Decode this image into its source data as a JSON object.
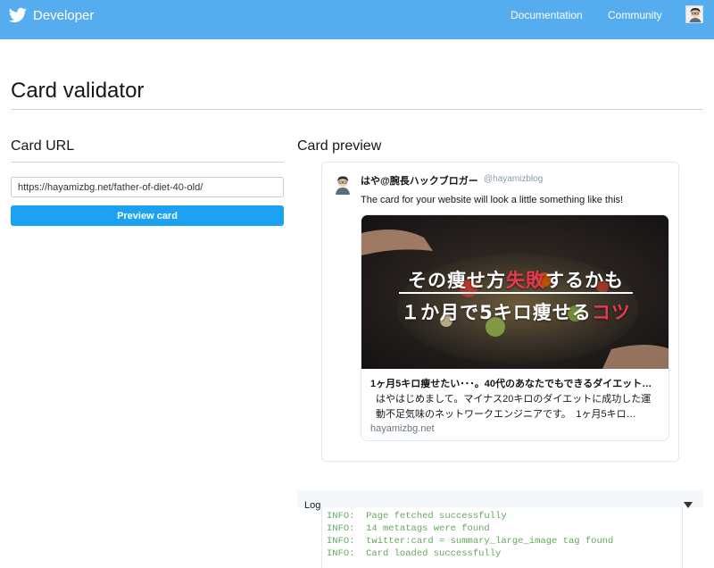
{
  "nav": {
    "brand": "Developer",
    "links": [
      "Documentation",
      "Community"
    ]
  },
  "page": {
    "title": "Card validator"
  },
  "card_url": {
    "heading": "Card URL",
    "input_value": "https://hayamizbg.net/father-of-diet-40-old/",
    "button_label": "Preview card"
  },
  "card_preview": {
    "heading": "Card preview",
    "tweet": {
      "name": "はや@腕長ハックブロガー",
      "handle": "@hayamizblog",
      "text": "The card for your website will look a little something like this!"
    },
    "card": {
      "image_line1_a": "その痩せ方",
      "image_line1_b": "失敗",
      "image_line1_c": "するかも",
      "image_line2_a": "１か月で5キロ痩せる",
      "image_line2_b": "コツ",
      "title": "1ヶ月5キロ痩せたい･･･。40代のあなたでもできるダイエット…",
      "description": "はやはじめまして。マイナス20キロのダイエットに成功した運動不足気味のネットワークエンジニアです。　1ヶ月5キロ…",
      "domain": "hayamizbg.net"
    }
  },
  "log": {
    "label": "Log",
    "lines": [
      "INFO:  Page fetched successfully",
      "INFO:  14 metatags were found",
      "INFO:  twitter:card = summary_large_image tag found",
      "INFO:  Card loaded successfully"
    ]
  },
  "colors": {
    "topbar": "#55acee",
    "button": "#1da1f2",
    "log_text": "#65a85f",
    "accent_red": "#e8384f"
  },
  "icons": {
    "brand": "twitter-bird-icon",
    "log_toggle": "triangle-down-icon"
  }
}
